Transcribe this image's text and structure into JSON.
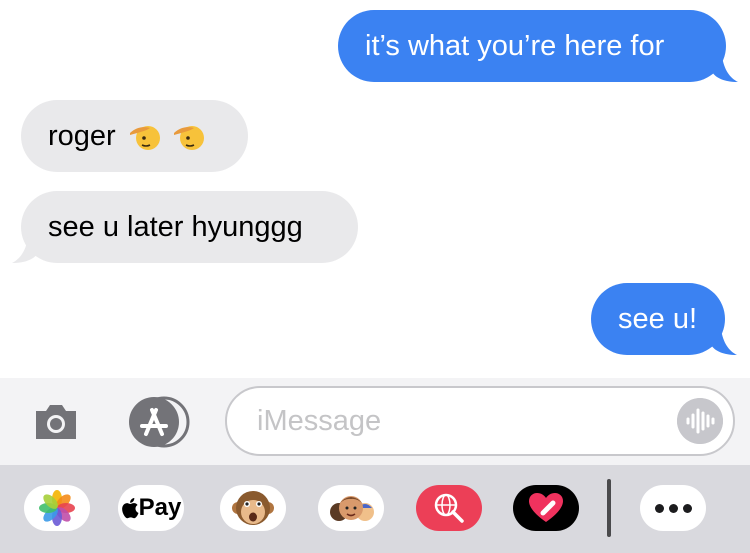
{
  "messages": [
    {
      "direction": "outgoing",
      "text": "it’s what you’re here for"
    },
    {
      "direction": "incoming",
      "text": "roger",
      "emoji": [
        "saluting-face",
        "saluting-face"
      ]
    },
    {
      "direction": "incoming",
      "text": "see u later hyunggg"
    },
    {
      "direction": "outgoing",
      "text": "see u!"
    }
  ],
  "input": {
    "placeholder": "iMessage",
    "buttons": [
      "camera-icon",
      "app-store-icon",
      "audio-waveform-icon"
    ]
  },
  "app_drawer": {
    "apps": [
      {
        "name": "photos-icon"
      },
      {
        "name": "apple-pay-icon",
        "label": "Pay"
      },
      {
        "name": "monkey-animoji-icon"
      },
      {
        "name": "memoji-stickers-icon"
      },
      {
        "name": "web-search-icon"
      },
      {
        "name": "digital-touch-heart-icon"
      },
      {
        "name": "more-apps-icon"
      }
    ]
  },
  "colors": {
    "outgoing_bubble": "#3b82f2",
    "incoming_bubble": "#e9e9eb",
    "input_bar_bg": "#f3f3f5",
    "drawer_bg": "#d9d9de"
  }
}
